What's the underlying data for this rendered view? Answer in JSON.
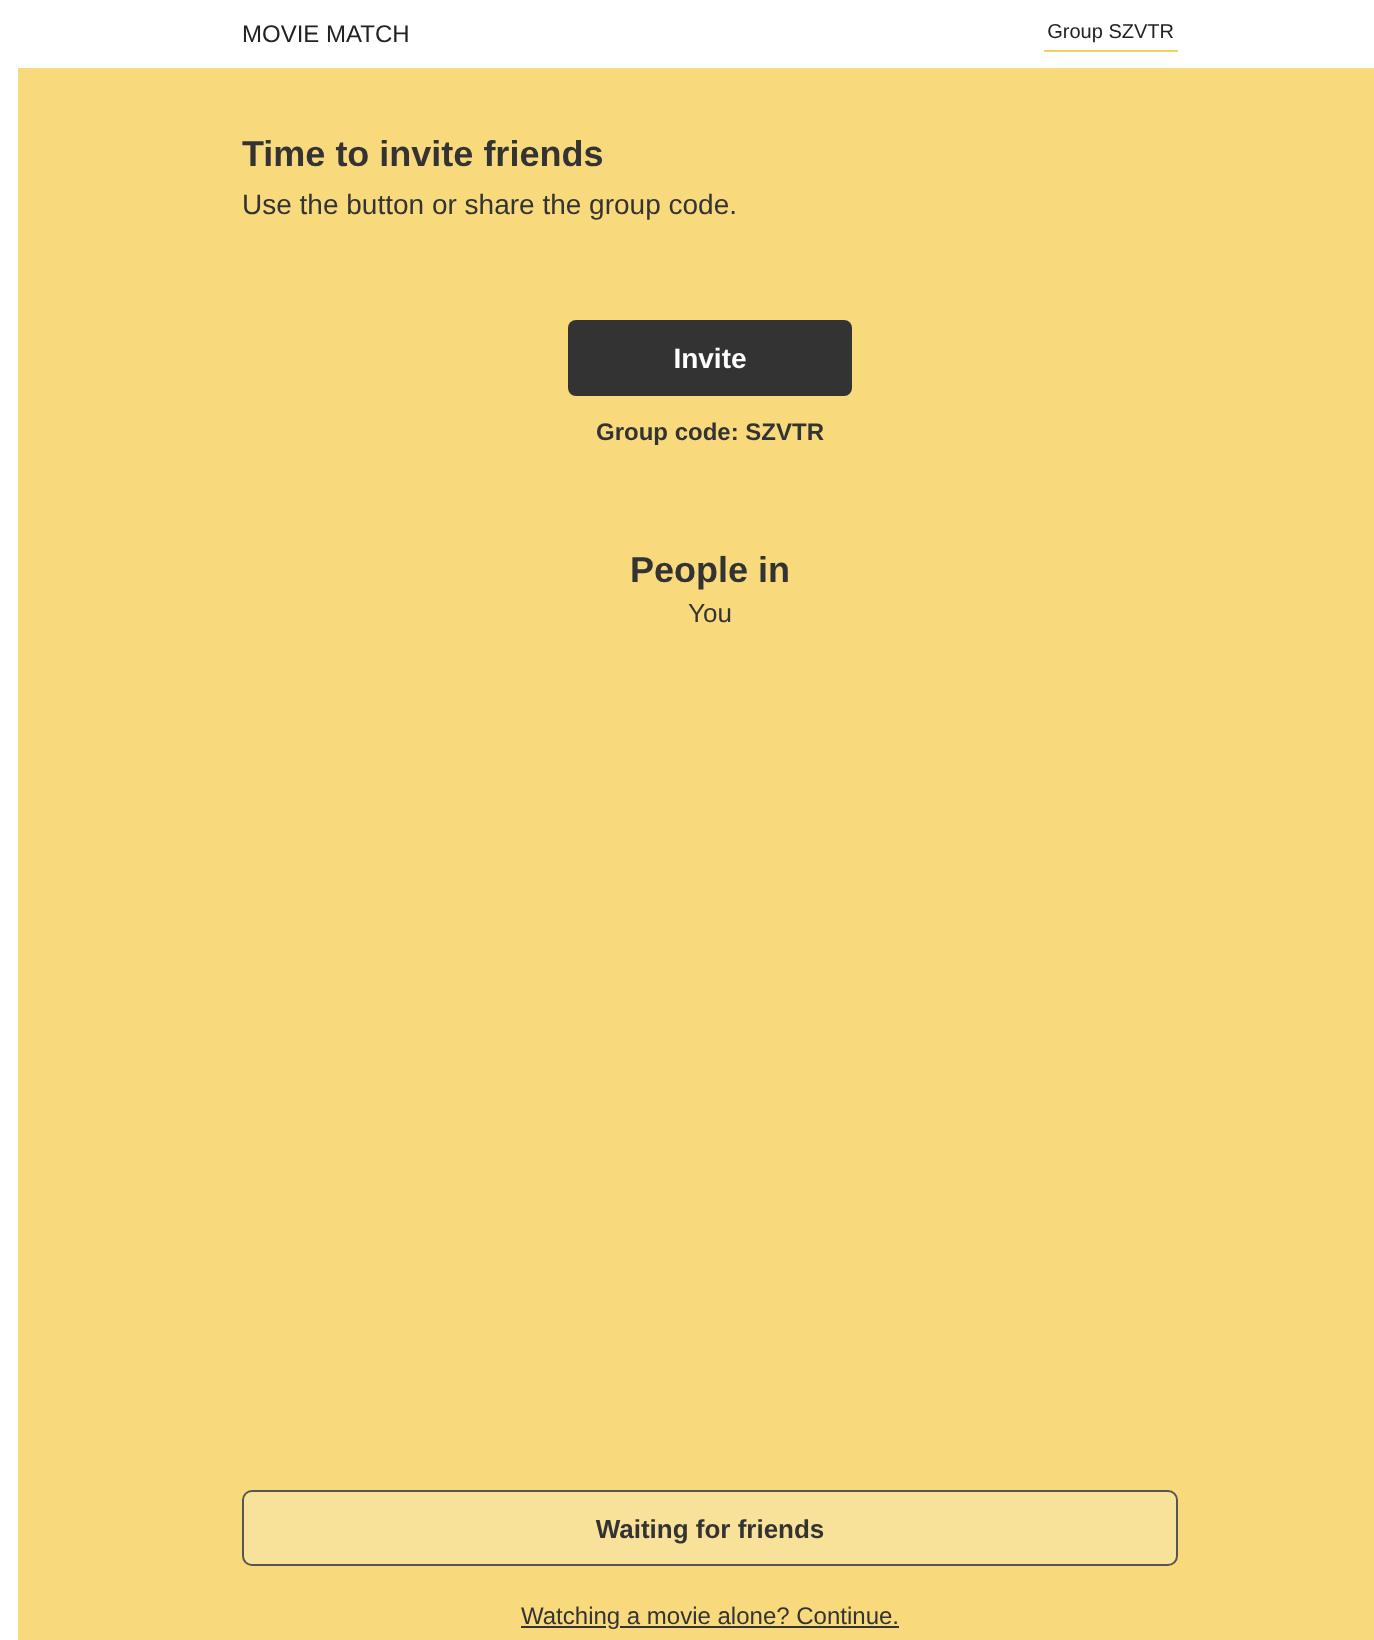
{
  "header": {
    "brand": "MOVIE MATCH",
    "group_link": {
      "label": "Group SZVTR",
      "selected": true
    }
  },
  "intro": {
    "title": "Time to invite friends",
    "subtitle": "Use the button or share the group code."
  },
  "invite_button": "Invite",
  "group_code": "Group code: SZVTR",
  "people": {
    "title": "People in",
    "members": [
      "You"
    ]
  },
  "waiting_button": {
    "label": "Waiting for friends",
    "disabled": true
  },
  "continue_link": "Watching a movie alone? Continue."
}
